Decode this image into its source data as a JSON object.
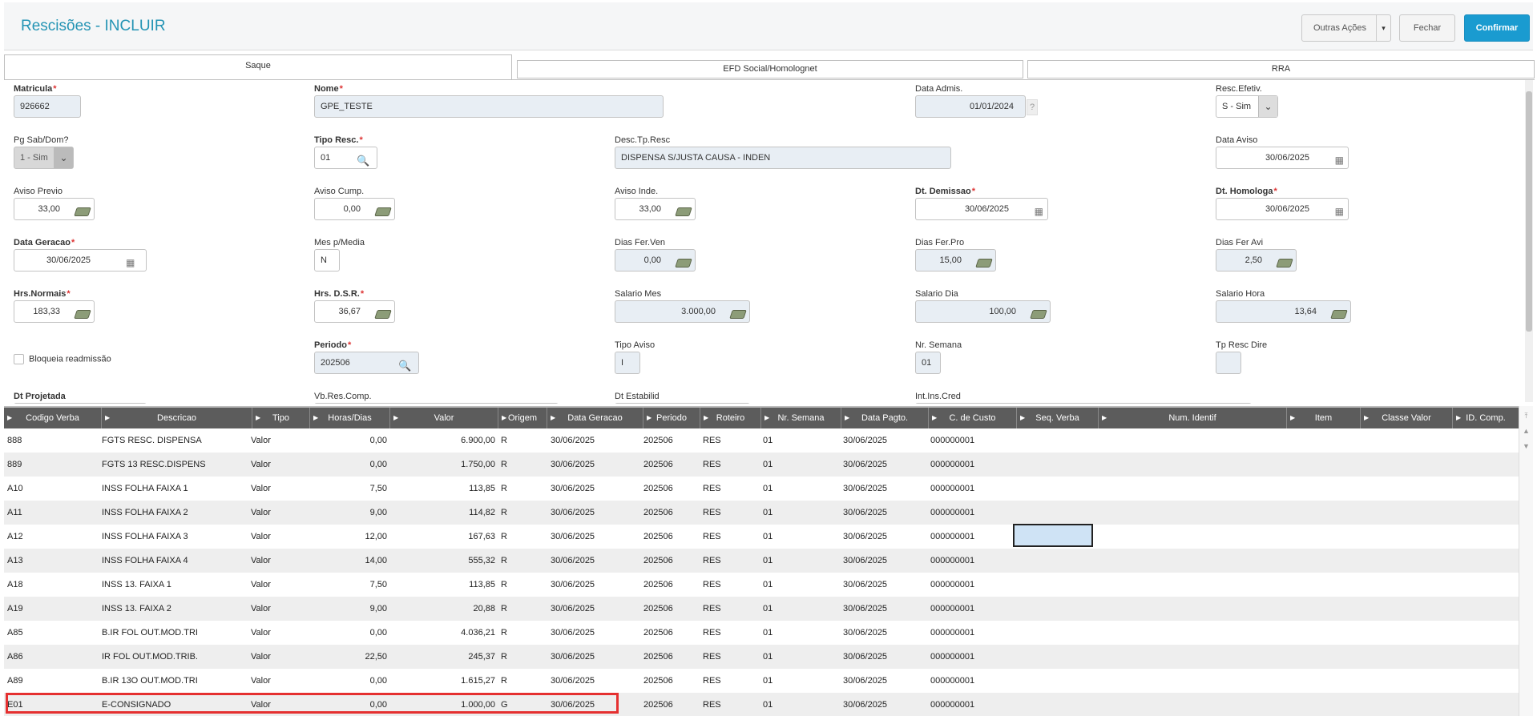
{
  "header": {
    "title": "Rescisões - INCLUIR",
    "buttons": {
      "outras": "Outras Ações",
      "fechar": "Fechar",
      "confirmar": "Confirmar"
    },
    "caret": "▾"
  },
  "tabs": [
    "Saque",
    "EFD Social/Homolognet",
    "RRA"
  ],
  "form": {
    "matricula": {
      "label": "Matricula",
      "value": "926662"
    },
    "nome": {
      "label": "Nome",
      "value": "GPE_TESTE"
    },
    "data_admis": {
      "label": "Data Admis.",
      "value": "01/01/2024"
    },
    "resc_efetiv": {
      "label": "Resc.Efetiv.",
      "value": "S - Sim"
    },
    "pg_sab_dom": {
      "label": "Pg Sab/Dom?",
      "value": "1 - Sim"
    },
    "tipo_resc": {
      "label": "Tipo Resc.",
      "value": "01"
    },
    "desc_tp_resc": {
      "label": "Desc.Tp.Resc",
      "value": "DISPENSA S/JUSTA CAUSA - INDEN"
    },
    "data_aviso": {
      "label": "Data Aviso",
      "value": "30/06/2025"
    },
    "aviso_previo": {
      "label": "Aviso Previo",
      "value": "33,00"
    },
    "aviso_cump": {
      "label": "Aviso Cump.",
      "value": "0,00"
    },
    "aviso_inde": {
      "label": "Aviso Inde.",
      "value": "33,00"
    },
    "dt_demissao": {
      "label": "Dt. Demissao",
      "value": "30/06/2025"
    },
    "dt_homologa": {
      "label": "Dt. Homologa",
      "value": "30/06/2025"
    },
    "data_geracao": {
      "label": "Data Geracao",
      "value": "30/06/2025"
    },
    "mes_media": {
      "label": "Mes p/Media",
      "value": "N"
    },
    "dias_fer_ven": {
      "label": "Dias Fer.Ven",
      "value": "0,00"
    },
    "dias_fer_pro": {
      "label": "Dias Fer.Pro",
      "value": "15,00"
    },
    "dias_fer_avi": {
      "label": "Dias Fer Avi",
      "value": "2,50"
    },
    "hrs_normais": {
      "label": "Hrs.Normais",
      "value": "183,33"
    },
    "hrs_dsr": {
      "label": "Hrs. D.S.R.",
      "value": "36,67"
    },
    "salario_mes": {
      "label": "Salario Mes",
      "value": "3.000,00"
    },
    "salario_dia": {
      "label": "Salario Dia",
      "value": "100,00"
    },
    "salario_hora": {
      "label": "Salario Hora",
      "value": "13,64"
    },
    "bloqueia": {
      "label": "Bloqueia readmissão"
    },
    "periodo": {
      "label": "Periodo",
      "value": "202506"
    },
    "tipo_aviso": {
      "label": "Tipo Aviso",
      "value": "I"
    },
    "nr_semana": {
      "label": "Nr. Semana",
      "value": "01"
    },
    "tp_resc_dire": {
      "label": "Tp Resc Dire",
      "value": ""
    },
    "dt_projetada": {
      "label": "Dt Projetada"
    },
    "vb_res_comp": {
      "label": "Vb.Res.Comp."
    },
    "dt_estabilid": {
      "label": "Dt Estabilid"
    },
    "int_ins_cred": {
      "label": "Int.Ins.Cred"
    },
    "help": "?"
  },
  "grid": {
    "columns": [
      "Codigo Verba",
      "Descricao",
      "Tipo",
      "Horas/Dias",
      "Valor",
      "Origem",
      "Data Geracao",
      "Periodo",
      "Roteiro",
      "Nr. Semana",
      "Data Pagto.",
      "C. de Custo",
      "Seq. Verba",
      "Num. Identif",
      "Item",
      "Classe Valor",
      "ID. Comp."
    ],
    "rows": [
      [
        "888",
        "FGTS RESC. DISPENSA",
        "Valor",
        "0,00",
        "6.900,00",
        "R",
        "30/06/2025",
        "202506",
        "RES",
        "01",
        "30/06/2025",
        "000000001"
      ],
      [
        "889",
        "FGTS 13 RESC.DISPENS",
        "Valor",
        "0,00",
        "1.750,00",
        "R",
        "30/06/2025",
        "202506",
        "RES",
        "01",
        "30/06/2025",
        "000000001"
      ],
      [
        "A10",
        "INSS FOLHA FAIXA 1",
        "Valor",
        "7,50",
        "113,85",
        "R",
        "30/06/2025",
        "202506",
        "RES",
        "01",
        "30/06/2025",
        "000000001"
      ],
      [
        "A11",
        "INSS FOLHA FAIXA 2",
        "Valor",
        "9,00",
        "114,82",
        "R",
        "30/06/2025",
        "202506",
        "RES",
        "01",
        "30/06/2025",
        "000000001"
      ],
      [
        "A12",
        "INSS FOLHA FAIXA 3",
        "Valor",
        "12,00",
        "167,63",
        "R",
        "30/06/2025",
        "202506",
        "RES",
        "01",
        "30/06/2025",
        "000000001"
      ],
      [
        "A13",
        "INSS FOLHA FAIXA 4",
        "Valor",
        "14,00",
        "555,32",
        "R",
        "30/06/2025",
        "202506",
        "RES",
        "01",
        "30/06/2025",
        "000000001"
      ],
      [
        "A18",
        "INSS 13. FAIXA 1",
        "Valor",
        "7,50",
        "113,85",
        "R",
        "30/06/2025",
        "202506",
        "RES",
        "01",
        "30/06/2025",
        "000000001"
      ],
      [
        "A19",
        "INSS 13. FAIXA 2",
        "Valor",
        "9,00",
        "20,88",
        "R",
        "30/06/2025",
        "202506",
        "RES",
        "01",
        "30/06/2025",
        "000000001"
      ],
      [
        "A85",
        "B.IR FOL OUT.MOD.TRI",
        "Valor",
        "0,00",
        "4.036,21",
        "R",
        "30/06/2025",
        "202506",
        "RES",
        "01",
        "30/06/2025",
        "000000001"
      ],
      [
        "A86",
        "IR FOL OUT.MOD.TRIB.",
        "Valor",
        "22,50",
        "245,37",
        "R",
        "30/06/2025",
        "202506",
        "RES",
        "01",
        "30/06/2025",
        "000000001"
      ],
      [
        "A89",
        "B.IR 13O OUT.MOD.TRI",
        "Valor",
        "0,00",
        "1.615,27",
        "R",
        "30/06/2025",
        "202506",
        "RES",
        "01",
        "30/06/2025",
        "000000001"
      ],
      [
        "E01",
        "E-CONSIGNADO",
        "Valor",
        "0,00",
        "1.000,00",
        "G",
        "30/06/2025",
        "202506",
        "RES",
        "01",
        "30/06/2025",
        "000000001"
      ]
    ]
  }
}
